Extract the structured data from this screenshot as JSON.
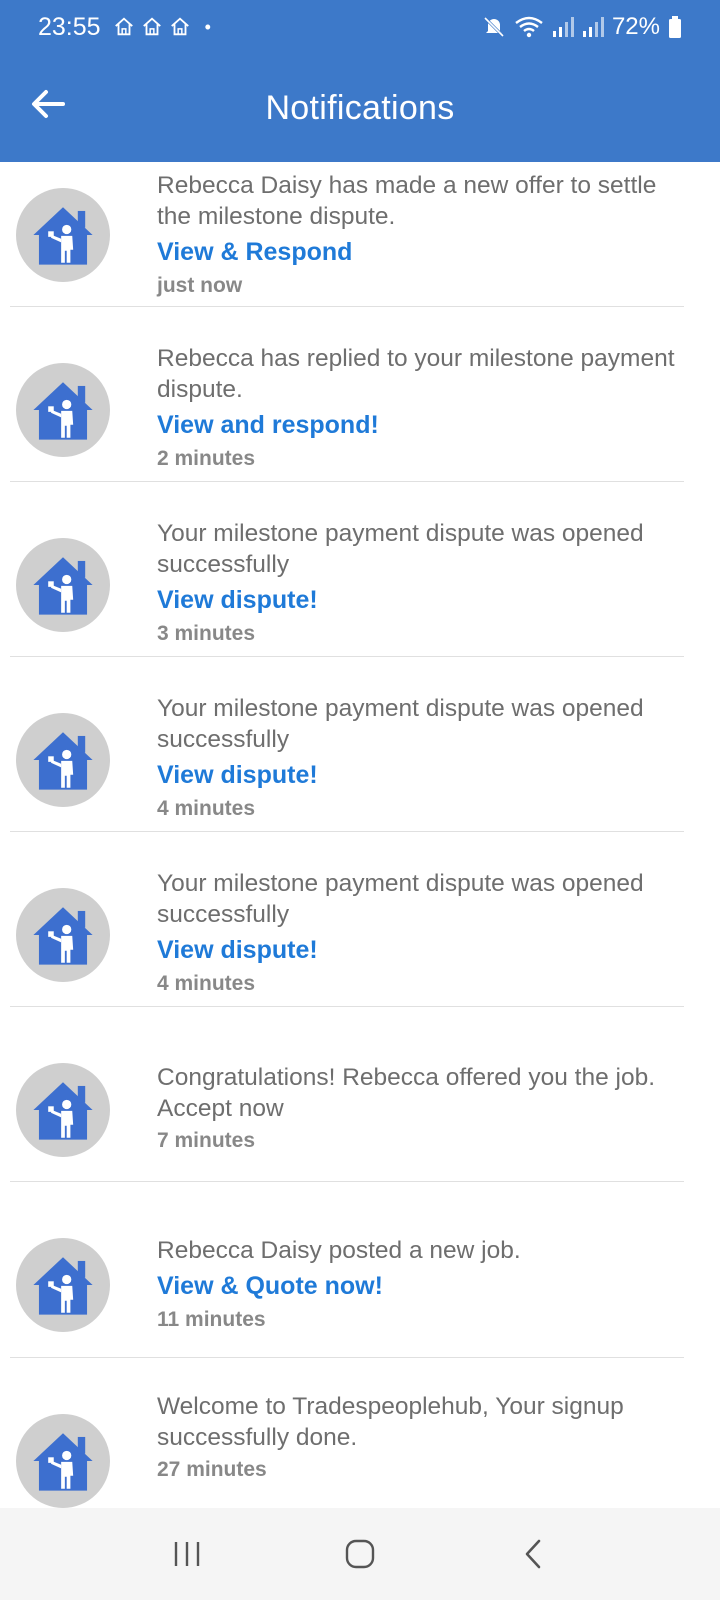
{
  "status_bar": {
    "time": "23:55",
    "dot": "•",
    "battery_percent": "72%",
    "icons": [
      "home-app-icon",
      "home-app-icon",
      "home-app-icon",
      "mute-icon",
      "wifi-icon",
      "signal-icon",
      "signal-icon",
      "battery-icon"
    ]
  },
  "app_bar": {
    "title": "Notifications",
    "back_icon": "arrow-left-icon"
  },
  "notifications": [
    {
      "message": "Rebecca Daisy has made a new offer to settle the milestone dispute.",
      "action": "View & Respond",
      "time": "just now"
    },
    {
      "message": "Rebecca has replied to your milestone payment dispute.",
      "action": "View and respond!",
      "time": "2 minutes"
    },
    {
      "message": "Your milestone payment dispute was opened successfully",
      "action": "View dispute!",
      "time": "3 minutes"
    },
    {
      "message": "Your milestone payment dispute was opened successfully",
      "action": "View dispute!",
      "time": "4 minutes"
    },
    {
      "message": "Your milestone payment dispute was opened successfully",
      "action": "View dispute!",
      "time": "4 minutes"
    },
    {
      "message": "Congratulations! Rebecca offered you the job. Accept now",
      "action": "",
      "time": "7 minutes"
    },
    {
      "message": "Rebecca Daisy posted a new job.",
      "action": "View & Quote now!",
      "time": "11 minutes"
    },
    {
      "message": "Welcome to Tradespeoplehub, Your signup successfully done.",
      "action": "",
      "time": "27 minutes"
    }
  ],
  "colors": {
    "primary": "#3d79c9",
    "link": "#1f7ad8",
    "message_text": "#6e6e6e",
    "time_text": "#888888"
  },
  "nav_bar": {
    "icons": [
      "recent-apps-icon",
      "home-icon",
      "back-icon"
    ]
  }
}
